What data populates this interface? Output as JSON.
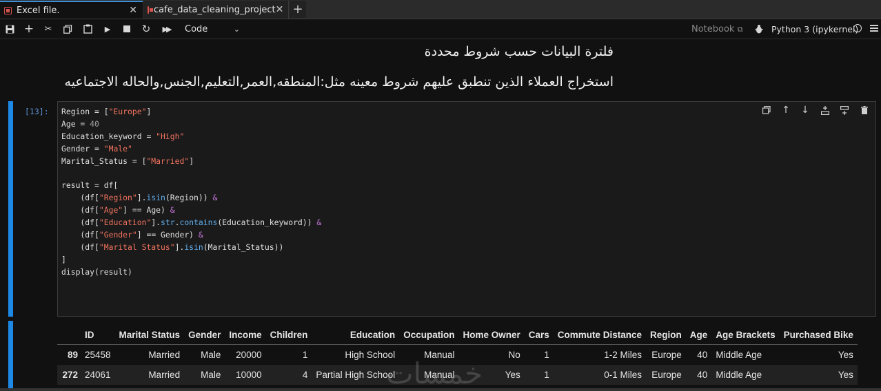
{
  "tabs": [
    {
      "label": "Excel file.",
      "active": true
    },
    {
      "label": "cafe_data_cleaning_project",
      "active": false
    }
  ],
  "toolbar": {
    "cell_type": "Code",
    "notebook_link": "Notebook",
    "kernel": "Python 3 (ipykernel)"
  },
  "markdown": {
    "heading": "فلترة البيانات حسب شروط محددة",
    "description": "استخراج العملاء الذين تنطبق عليهم شروط معينه مثل:المنطقه,العمر,التعليم,الجنس,والحاله الاجتماعيه"
  },
  "cell": {
    "prompt": "[13]:"
  },
  "output_table": {
    "columns": [
      "",
      "ID",
      "Marital Status",
      "Gender",
      "Income",
      "Children",
      "Education",
      "Occupation",
      "Home Owner",
      "Cars",
      "Commute Distance",
      "Region",
      "Age",
      "Age Brackets",
      "Purchased Bike"
    ],
    "rows": [
      [
        "89",
        "25458",
        "Married",
        "Male",
        "20000",
        "1",
        "High School",
        "Manual",
        "No",
        "1",
        "1-2 Miles",
        "Europe",
        "40",
        "Middle Age",
        "Yes"
      ],
      [
        "272",
        "24061",
        "Married",
        "Male",
        "10000",
        "4",
        "Partial High School",
        "Manual",
        "Yes",
        "1",
        "0-1 Miles",
        "Europe",
        "40",
        "Middle Age",
        "Yes"
      ]
    ]
  },
  "watermark": "خمسات",
  "colors": {
    "accent": "#1e88e5",
    "string": "#f2735f",
    "number": "#a0a0a0",
    "operator": "#c678dd",
    "method": "#61afef",
    "background": "#111111"
  }
}
